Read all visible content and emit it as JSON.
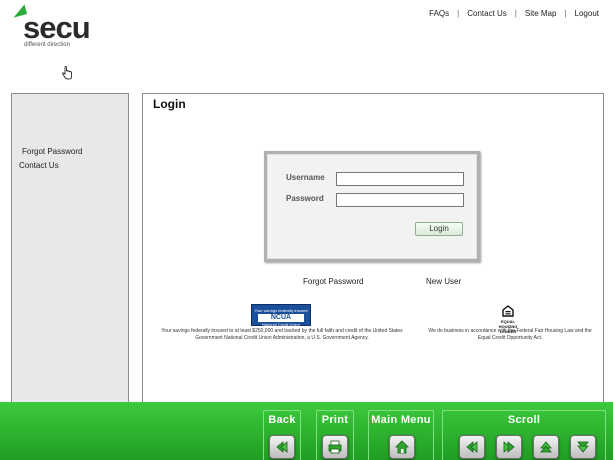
{
  "logo": {
    "name": "secu",
    "tagline": "different direction"
  },
  "topnav": {
    "faqs": "FAQs",
    "contact": "Contact Us",
    "sitemap": "Site Map",
    "logout": "Logout"
  },
  "sidebar": {
    "items": [
      {
        "label": "Forgot Password"
      },
      {
        "label": "Contact Us"
      }
    ]
  },
  "main": {
    "title": "Login",
    "form": {
      "username_label": "Username",
      "username_value": "",
      "password_label": "Password",
      "password_value": "",
      "login_label": "Login"
    },
    "links": {
      "forgot": "Forgot Password",
      "new_user": "New User"
    },
    "ncua": {
      "top": "Your savings federally insured",
      "mid": "NCUA",
      "bottom": "National Credit Union Administration"
    },
    "ncua_disclaimer": "Your savings federally insured to at least $250,000 and backed by the full faith and credit of the United States Government National Credit Union Administration, a U.S. Government Agency.",
    "eho": {
      "caption": "EQUAL HOUSING LENDER"
    },
    "eho_disclaimer": "We do business in accordance with the Federal Fair Housing Law and the Equal Credit Opportunity Act."
  },
  "bottombar": {
    "back": "Back",
    "print": "Print",
    "main_menu": "Main Menu",
    "scroll": "Scroll"
  },
  "colors": {
    "brand_green": "#2cab3a",
    "bar_green": "#2fb52f",
    "panel_border": "#8c8c8c"
  }
}
